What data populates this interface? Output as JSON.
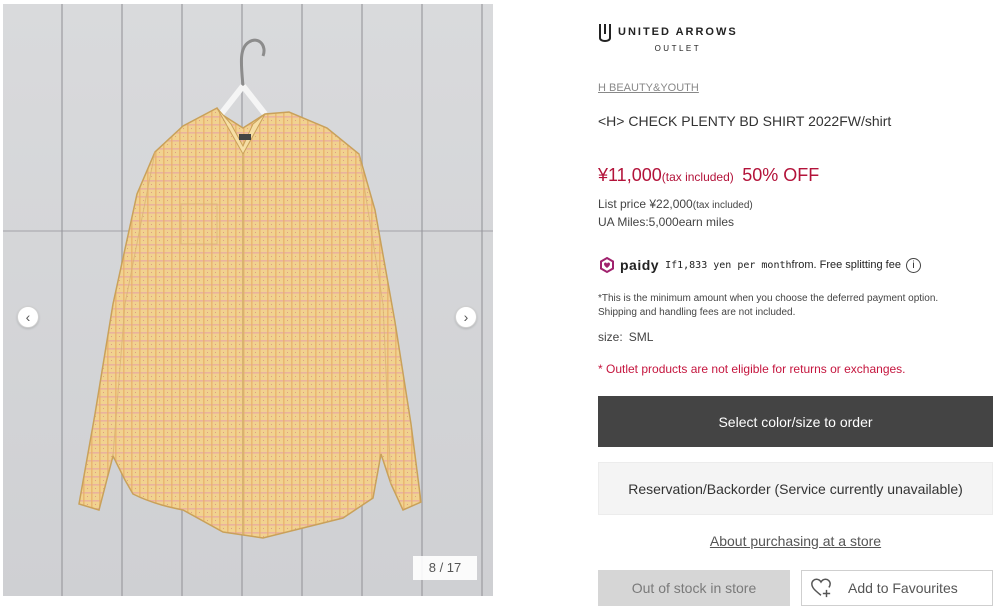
{
  "gallery": {
    "counter": "8 / 17",
    "prev_icon": "chevron-left-icon",
    "next_icon": "chevron-right-icon"
  },
  "logo": {
    "name": "UNITED ARROWS",
    "sub": "OUTLET"
  },
  "product": {
    "brand": "H BEAUTY&YOUTH",
    "name": "<H> CHECK PLENTY BD SHIRT 2022FW/shirt",
    "price": "¥11,000",
    "tax_note": "(tax included)",
    "discount": "50% OFF",
    "list_price_label": "List price ¥22,000",
    "list_price_tax": "(tax included)",
    "miles": "UA Miles:5,000earn miles",
    "size_label": "size:",
    "size_value": "SML"
  },
  "paidy": {
    "logo_text": "paidy",
    "mono_text": "If1,833 yen per month",
    "suffix": "from. Free splitting fee",
    "info_icon": "info-icon",
    "note_line1": "*This is the minimum amount when you choose the deferred payment option.",
    "note_line2": "Shipping and handling fees are not included."
  },
  "outlet_note": "* Outlet products are not eligible for returns or exchanges.",
  "buttons": {
    "select": "Select color/size to order",
    "reserve": "Reservation/Backorder (Service currently unavailable)",
    "store_link": "About purchasing at a store",
    "out_of_stock": "Out of stock in store",
    "favourite": "Add to Favourites"
  },
  "colors": {
    "price_red": "#b3133a",
    "dark_button": "#444444"
  }
}
